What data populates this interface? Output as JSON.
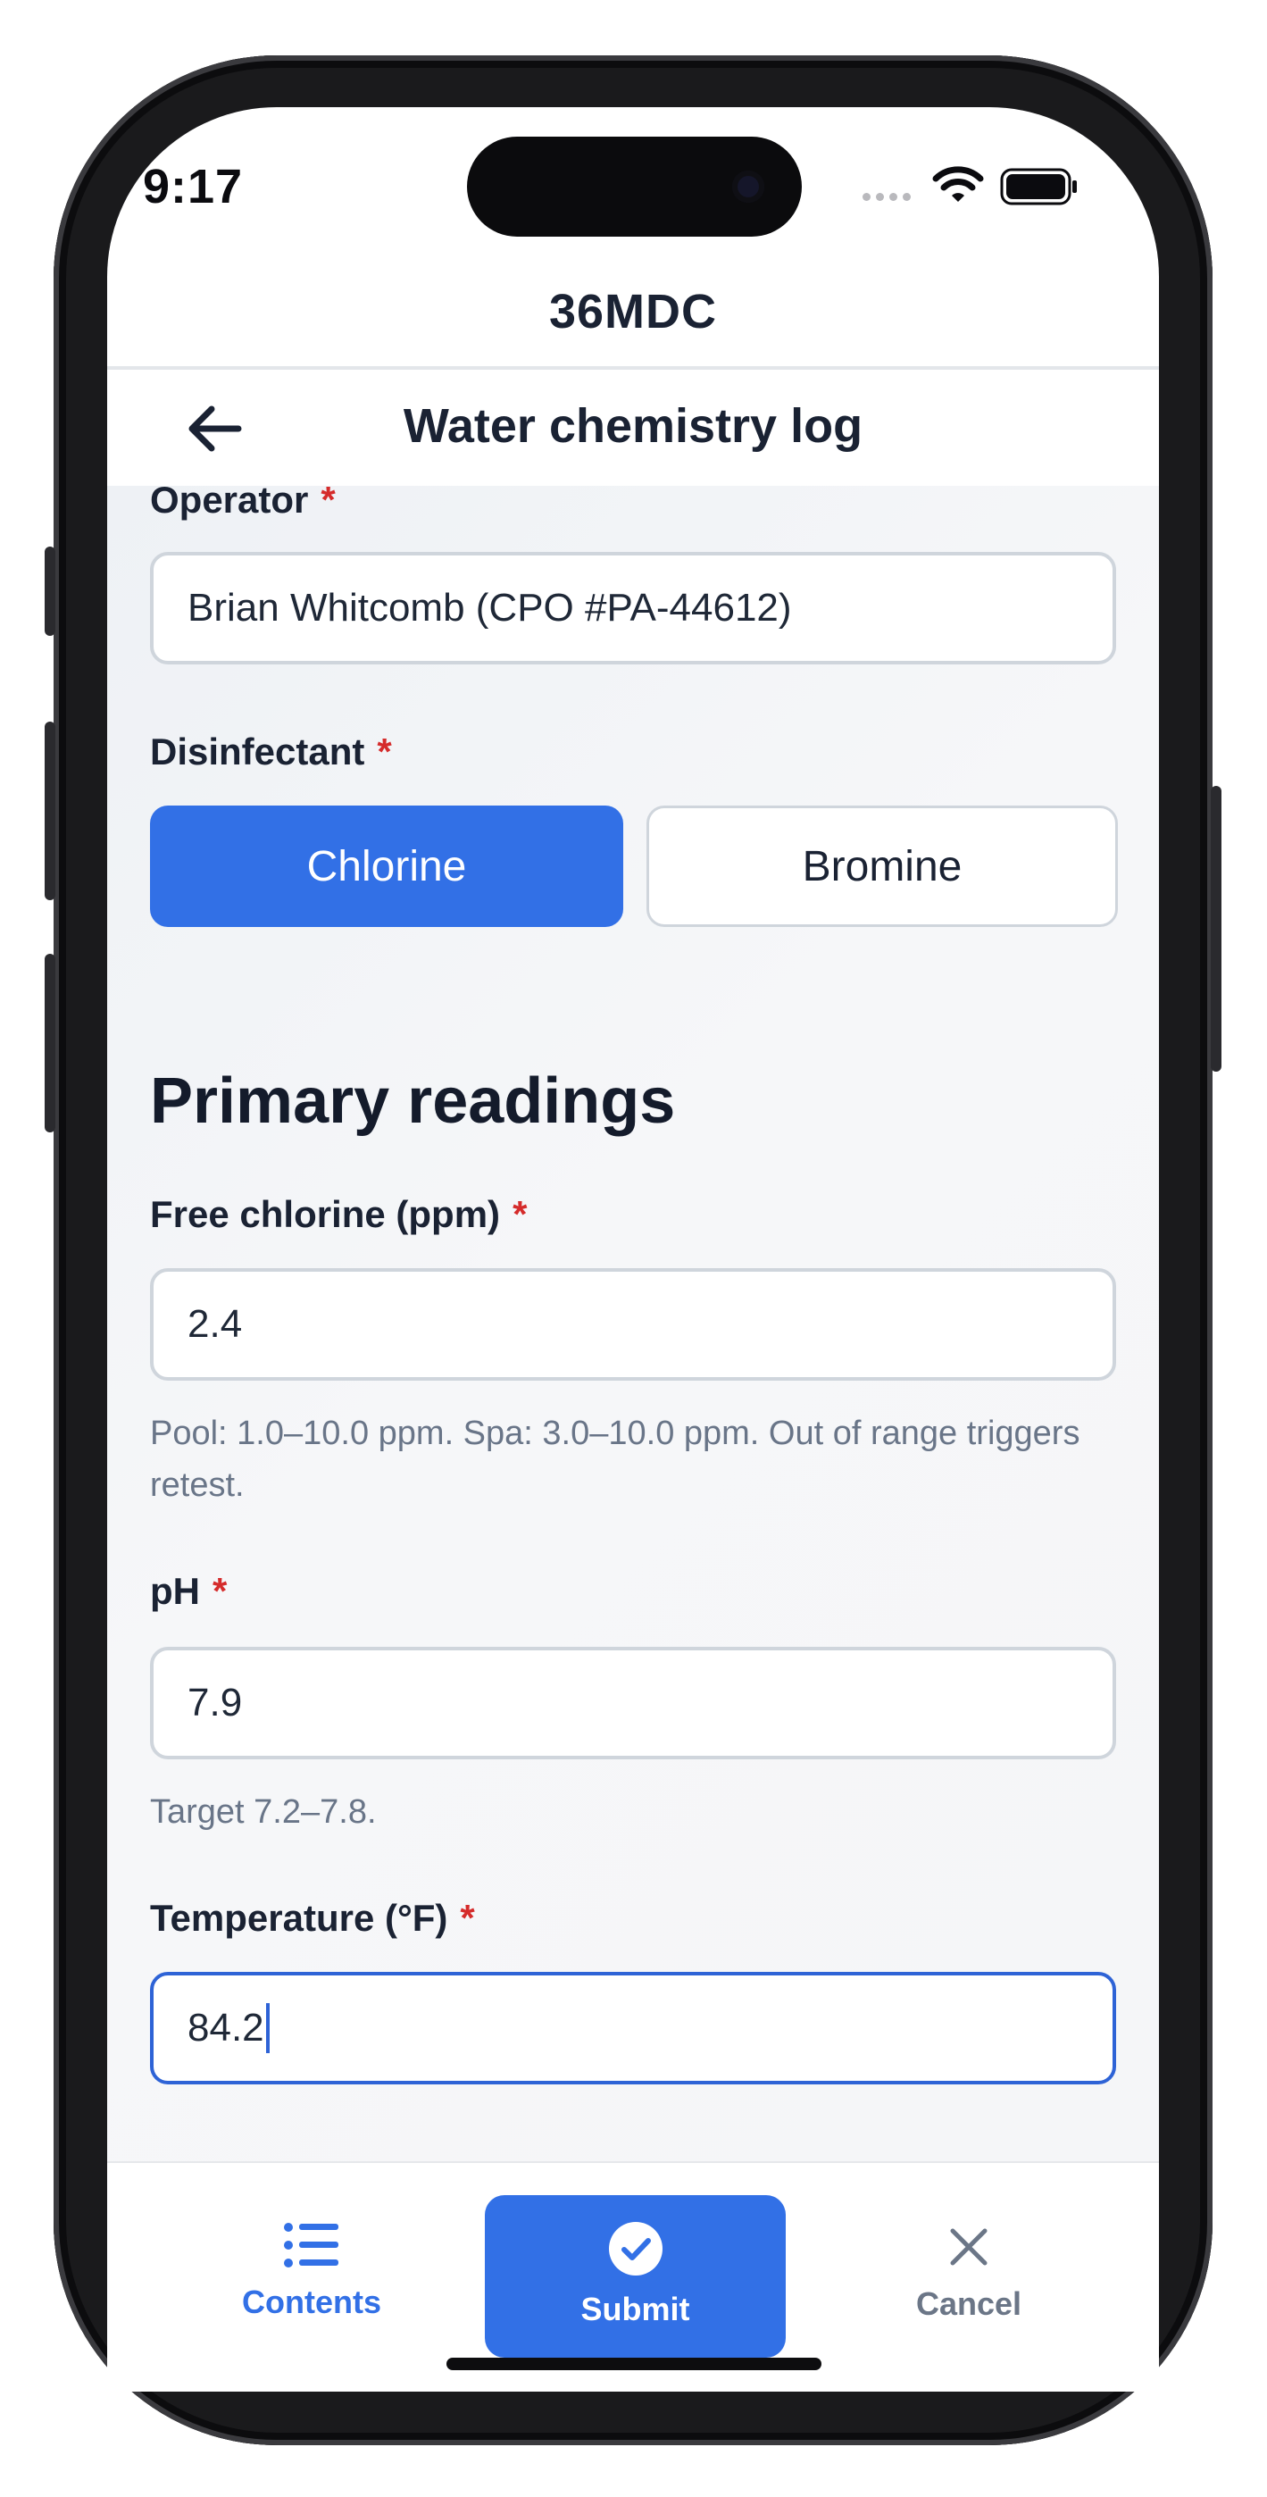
{
  "status_bar": {
    "time": "9:17"
  },
  "app": {
    "title": "36MDC"
  },
  "nav": {
    "title": "Water chemistry log"
  },
  "form": {
    "operator": {
      "label": "Operator",
      "required": "*",
      "value": "Brian Whitcomb (CPO #PA-44612)"
    },
    "disinfectant": {
      "label": "Disinfectant",
      "required": "*",
      "options": [
        "Chlorine",
        "Bromine"
      ],
      "selected": "Chlorine"
    },
    "section_title": "Primary readings",
    "free_chlorine": {
      "label": "Free chlorine (ppm)",
      "required": "*",
      "value": "2.4",
      "help": "Pool: 1.0–10.0 ppm. Spa: 3.0–10.0 ppm. Out of range triggers retest."
    },
    "ph": {
      "label": "pH",
      "required": "*",
      "value": "7.9",
      "help": "Target 7.2–7.8."
    },
    "temperature": {
      "label": "Temperature (°F)",
      "required": "*",
      "value": "84.2"
    }
  },
  "bottom_bar": {
    "contents_label": "Contents",
    "submit_label": "Submit",
    "cancel_label": "Cancel"
  },
  "colors": {
    "accent": "#3270e6",
    "required": "#d52b2b",
    "text_primary": "#1a2233",
    "text_muted": "#697588",
    "cancel_gray": "#6b7687"
  },
  "icons": {
    "back": "arrow-left-icon",
    "contents": "list-icon",
    "submit": "check-circle-icon",
    "cancel": "close-icon"
  }
}
